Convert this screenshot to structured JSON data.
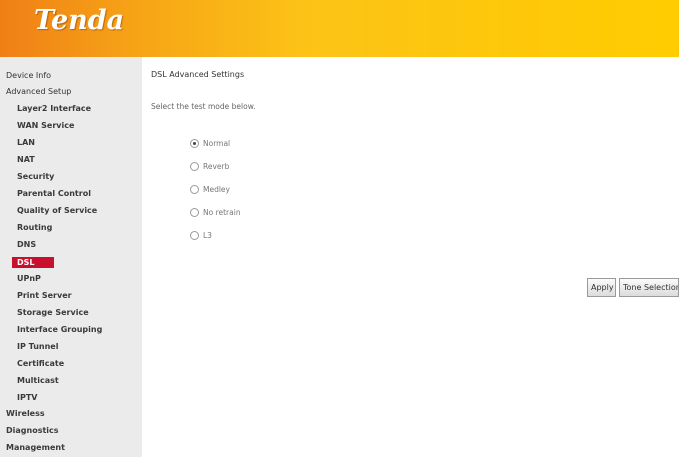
{
  "brand": {
    "logo_text": "Tenda"
  },
  "sidebar": {
    "items": [
      {
        "label": "Device Info",
        "level": "top"
      },
      {
        "label": "Advanced Setup",
        "level": "top"
      },
      {
        "label": "Layer2 Interface",
        "level": "sub"
      },
      {
        "label": "WAN Service",
        "level": "sub"
      },
      {
        "label": "LAN",
        "level": "sub"
      },
      {
        "label": "NAT",
        "level": "sub"
      },
      {
        "label": "Security",
        "level": "sub"
      },
      {
        "label": "Parental Control",
        "level": "sub"
      },
      {
        "label": "Quality of Service",
        "level": "sub"
      },
      {
        "label": "Routing",
        "level": "sub"
      },
      {
        "label": "DNS",
        "level": "sub"
      },
      {
        "label": "DSL",
        "level": "sub",
        "active": true
      },
      {
        "label": "UPnP",
        "level": "sub"
      },
      {
        "label": "Print Server",
        "level": "sub"
      },
      {
        "label": "Storage Service",
        "level": "sub"
      },
      {
        "label": "Interface Grouping",
        "level": "sub"
      },
      {
        "label": "IP Tunnel",
        "level": "sub"
      },
      {
        "label": "Certificate",
        "level": "sub"
      },
      {
        "label": "Multicast",
        "level": "sub"
      },
      {
        "label": "IPTV",
        "level": "sub"
      },
      {
        "label": "Wireless",
        "level": "top"
      },
      {
        "label": "Diagnostics",
        "level": "top"
      },
      {
        "label": "Management",
        "level": "top"
      }
    ]
  },
  "main": {
    "title": "DSL Advanced Settings",
    "instruction": "Select the test mode below.",
    "modes": [
      {
        "label": "Normal",
        "selected": true
      },
      {
        "label": "Reverb",
        "selected": false
      },
      {
        "label": "Medley",
        "selected": false
      },
      {
        "label": "No retrain",
        "selected": false
      },
      {
        "label": "L3",
        "selected": false
      }
    ],
    "apply_label": "Apply",
    "tone_selection_label": "Tone Selection"
  },
  "colors": {
    "header_orange": "#f07f16",
    "header_yellow": "#ffcc00",
    "active_red": "#c8102e",
    "sidebar_bg": "#ebebeb"
  }
}
